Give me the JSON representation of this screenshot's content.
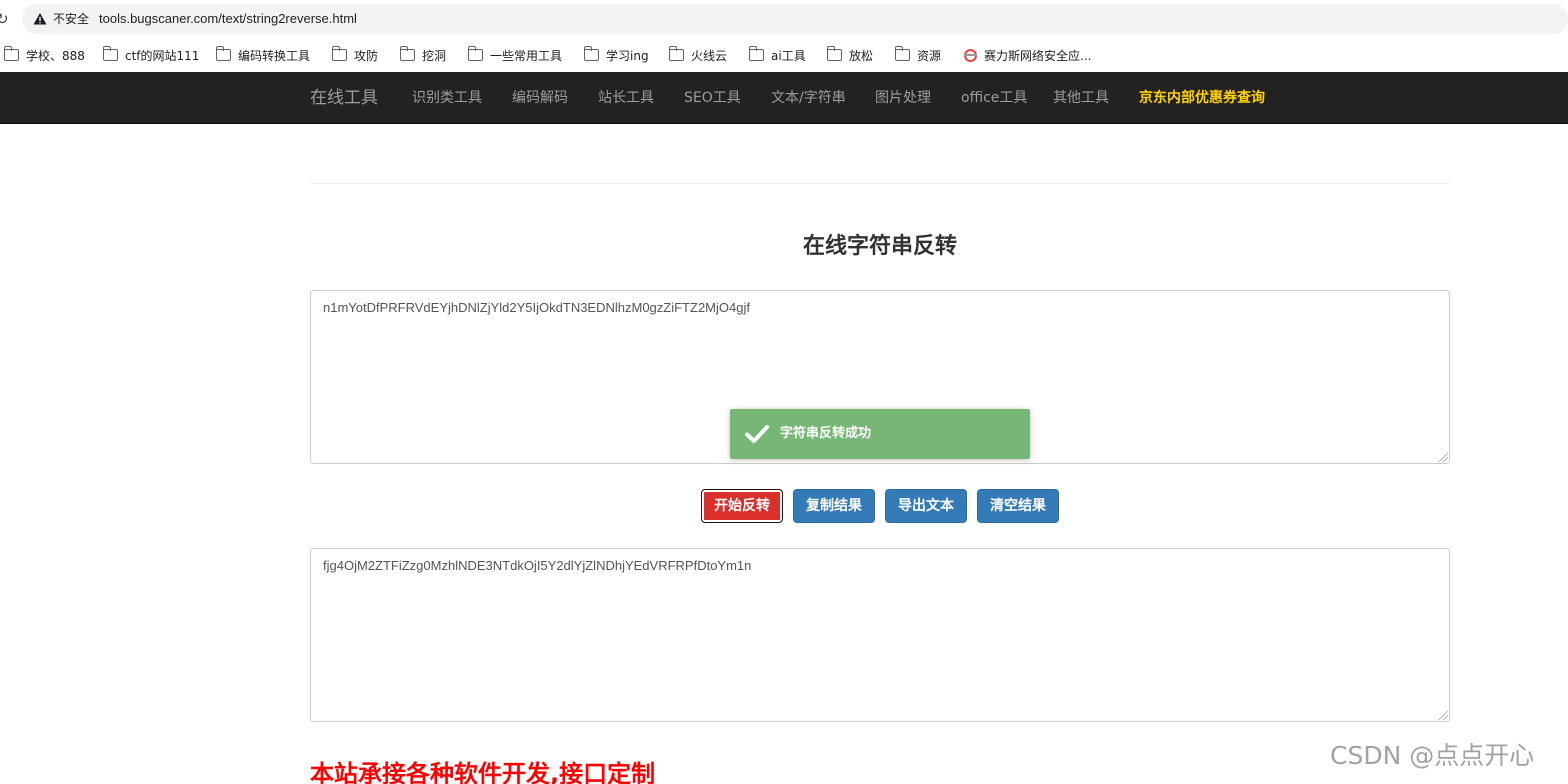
{
  "browser": {
    "security_label": "不安全",
    "url": "tools.bugscaner.com/text/string2reverse.html",
    "icons": {
      "reload": "reload-icon",
      "warning": "warning-icon"
    }
  },
  "bookmarks": [
    {
      "label": "学校、888",
      "icon": "folder-icon"
    },
    {
      "label": "ctf的网站111",
      "icon": "folder-icon"
    },
    {
      "label": "编码转换工具",
      "icon": "folder-icon"
    },
    {
      "label": "攻防",
      "icon": "folder-icon"
    },
    {
      "label": "挖洞",
      "icon": "folder-icon"
    },
    {
      "label": "一些常用工具",
      "icon": "folder-icon"
    },
    {
      "label": "学习ing",
      "icon": "folder-icon"
    },
    {
      "label": "火线云",
      "icon": "folder-icon"
    },
    {
      "label": "ai工具",
      "icon": "folder-icon"
    },
    {
      "label": "放松",
      "icon": "folder-icon"
    },
    {
      "label": "资源",
      "icon": "folder-icon"
    },
    {
      "label": "赛力斯网络安全应...",
      "icon": "globe-icon"
    }
  ],
  "navbar": {
    "brand": "在线工具",
    "items": [
      "识别类工具",
      "编码解码",
      "站长工具",
      "SEO工具",
      "文本/字符串",
      "图片处理",
      "office工具",
      "其他工具"
    ],
    "highlight": "京东内部优惠券查询",
    "highlight_color": "#ffd200",
    "background": "#222222"
  },
  "page": {
    "title": "在线字符串反转",
    "input_text": "n1mYotDfPRFRVdEYjhDNlZjYld2Y5IjOkdTN3EDNlhzM0gzZiFTZ2MjO4gjf",
    "output_text": "fjg4OjM2ZTFiZzg0MzhlNDE3NTdkOjI5Y2dlYjZlNDhjYEdVRFRPfDtoYm1n",
    "toast": {
      "text": "字符串反转成功",
      "icon": "check-icon",
      "color": "#76b776"
    },
    "buttons": {
      "reverse": "开始反转",
      "copy": "复制结果",
      "export": "导出文本",
      "clear": "清空结果"
    },
    "promo": "本站承接各种软件开发,接口定制",
    "watermark": "CSDN @点点开心"
  }
}
